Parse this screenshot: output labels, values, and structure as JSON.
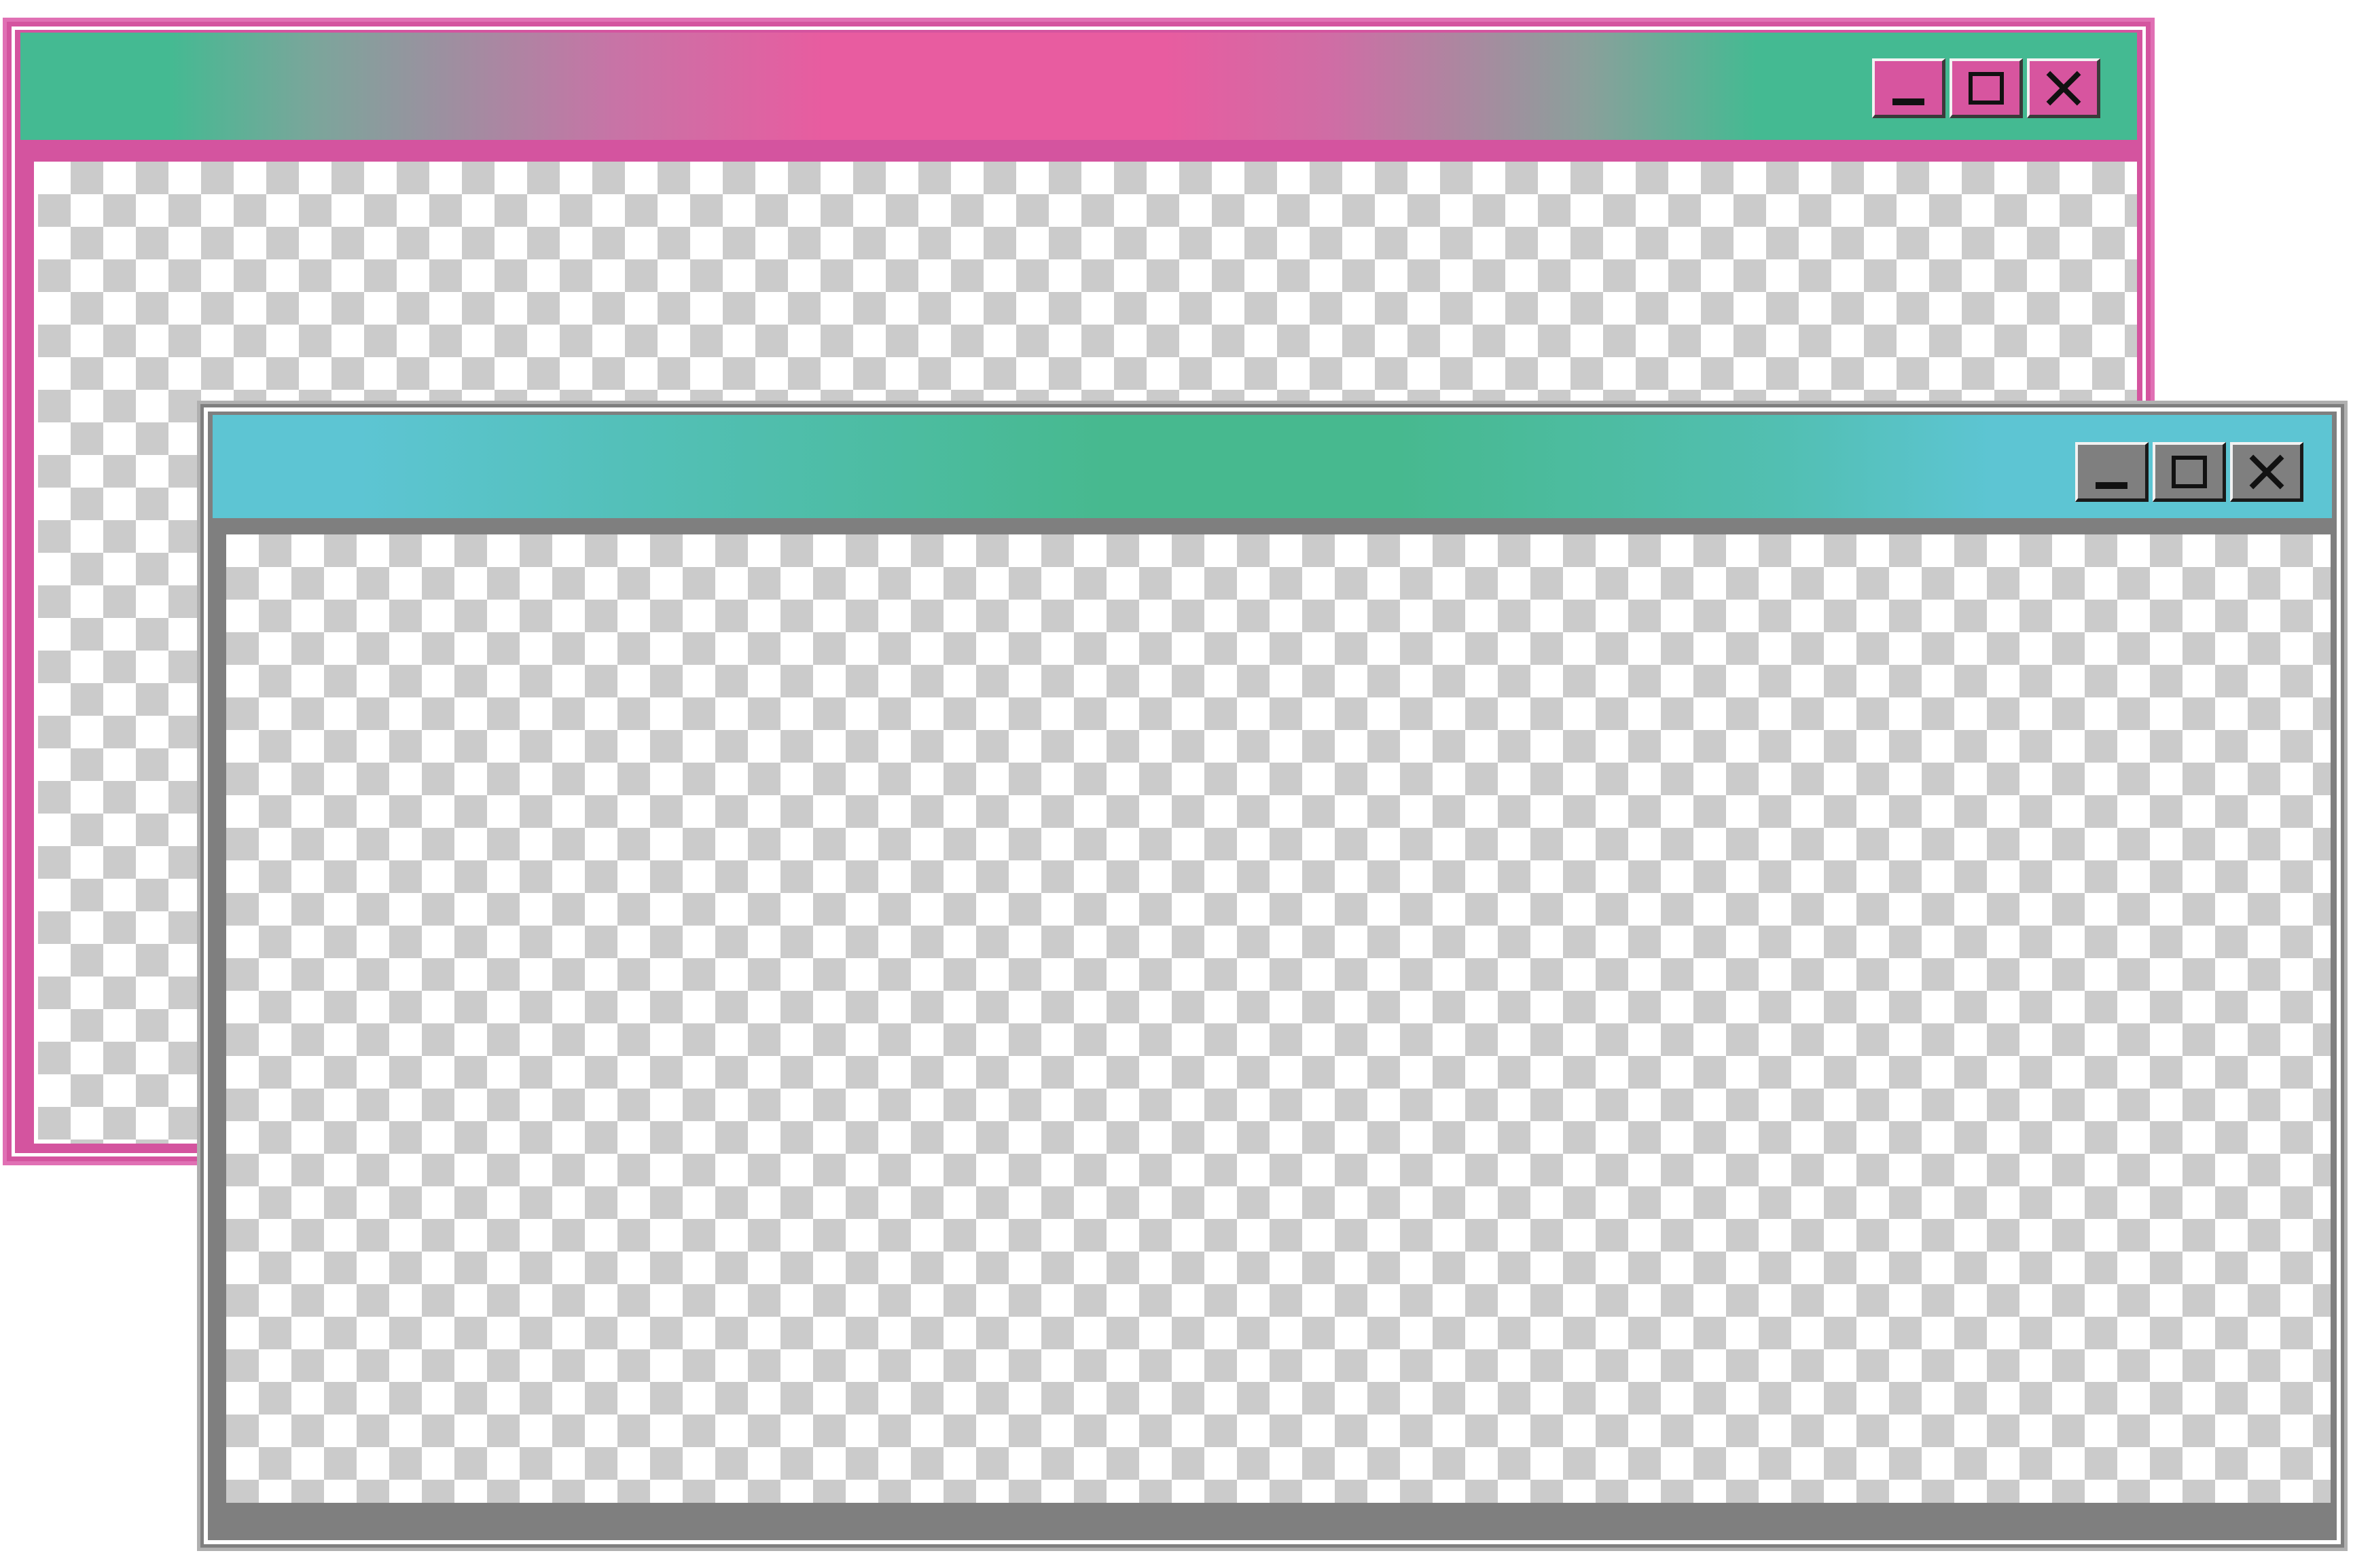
{
  "windows": [
    {
      "id": "back",
      "title": "",
      "accent_color": "#d4549f",
      "titlebar_colors": [
        "#44ba92",
        "#e85ca0",
        "#44ba92"
      ],
      "content": "transparent-checkerboard",
      "controls": [
        {
          "icon": "minimize-icon"
        },
        {
          "icon": "maximize-icon"
        },
        {
          "icon": "close-icon"
        }
      ],
      "active": false
    },
    {
      "id": "front",
      "title": "",
      "accent_color": "#7f7f7f",
      "titlebar_colors": [
        "#5dc5d3",
        "#47b98f",
        "#5dc5d3"
      ],
      "content": "transparent-checkerboard",
      "controls": [
        {
          "icon": "minimize-icon"
        },
        {
          "icon": "maximize-icon"
        },
        {
          "icon": "close-icon"
        }
      ],
      "active": true
    }
  ]
}
